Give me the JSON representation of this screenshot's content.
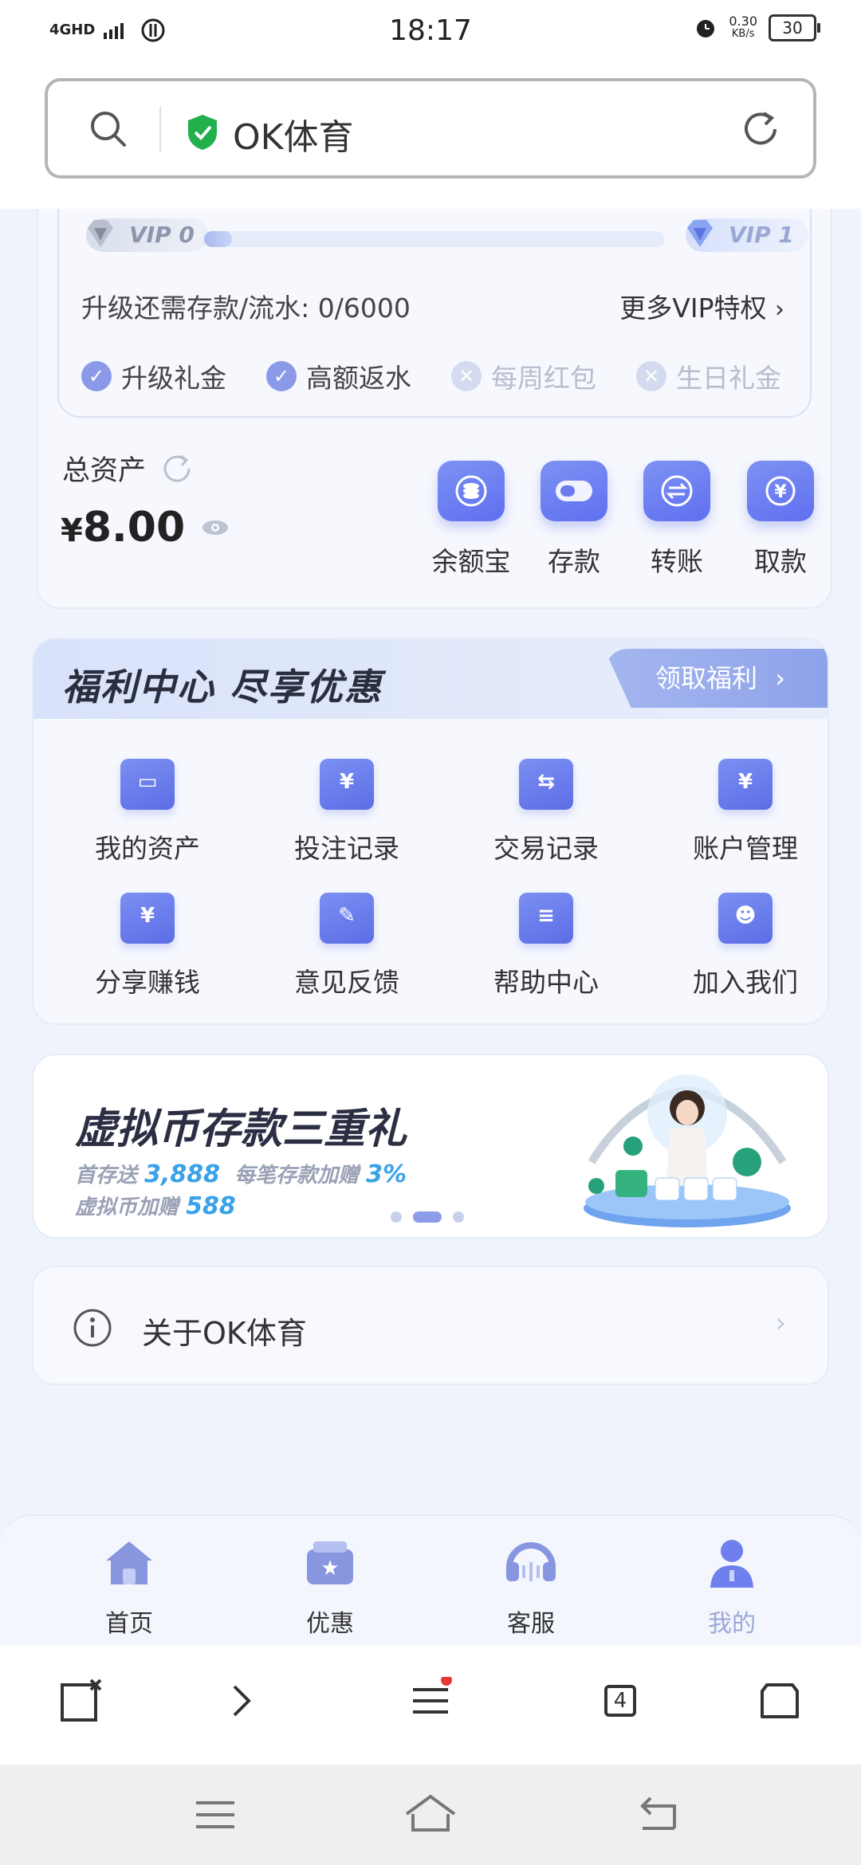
{
  "status_bar": {
    "time": "18:17",
    "network": "4GHD",
    "speed": "0.30",
    "speed_unit": "KB/s",
    "battery": "30"
  },
  "url_bar": {
    "title": "OK体育"
  },
  "vip": {
    "current_level": "VIP 0",
    "next_level": "VIP 1",
    "progress": 0.05,
    "upgrade_label": "升级还需存款/流水:",
    "upgrade_value": "0/6000",
    "more_label": "更多VIP特权",
    "perks": [
      {
        "label": "升级礼金",
        "enabled": true
      },
      {
        "label": "高额返水",
        "enabled": true
      },
      {
        "label": "每周红包",
        "enabled": false
      },
      {
        "label": "生日礼金",
        "enabled": false
      }
    ]
  },
  "assets": {
    "label": "总资产",
    "currency": "¥",
    "amount": "8.00"
  },
  "quick_actions": [
    {
      "label": "余额宝",
      "icon": "coins-icon"
    },
    {
      "label": "存款",
      "icon": "wallet-card-icon"
    },
    {
      "label": "转账",
      "icon": "transfer-icon"
    },
    {
      "label": "取款",
      "icon": "yen-withdraw-icon"
    }
  ],
  "welfare": {
    "title": "福利中心 尽享优惠",
    "button": "领取福利",
    "items": [
      {
        "label": "我的资产",
        "glyph": "▭"
      },
      {
        "label": "投注记录",
        "glyph": "¥"
      },
      {
        "label": "交易记录",
        "glyph": "⇆"
      },
      {
        "label": "账户管理",
        "glyph": "¥"
      },
      {
        "label": "分享赚钱",
        "glyph": "¥"
      },
      {
        "label": "意见反馈",
        "glyph": "✎"
      },
      {
        "label": "帮助中心",
        "glyph": "≡"
      },
      {
        "label": "加入我们",
        "glyph": "☻"
      }
    ]
  },
  "banner": {
    "title": "虚拟币存款三重礼",
    "line1_a": "首存送",
    "line1_b": "3,888",
    "line1_c": "每笔存款加赠",
    "line1_d": "3%",
    "line2_a": "虚拟币加赠",
    "line2_b": "588"
  },
  "about": {
    "label": "关于OK体育"
  },
  "tabs": [
    {
      "label": "首页",
      "icon": "home-icon"
    },
    {
      "label": "优惠",
      "icon": "gift-icon"
    },
    {
      "label": "客服",
      "icon": "headset-icon"
    },
    {
      "label": "我的",
      "icon": "profile-icon"
    }
  ],
  "browser_toolbar": {
    "tab_count": "4"
  },
  "colors": {
    "accent": "#6f80ee",
    "active_tab": "#9ba8d8",
    "banner_highlight": "#3aa2e8"
  }
}
